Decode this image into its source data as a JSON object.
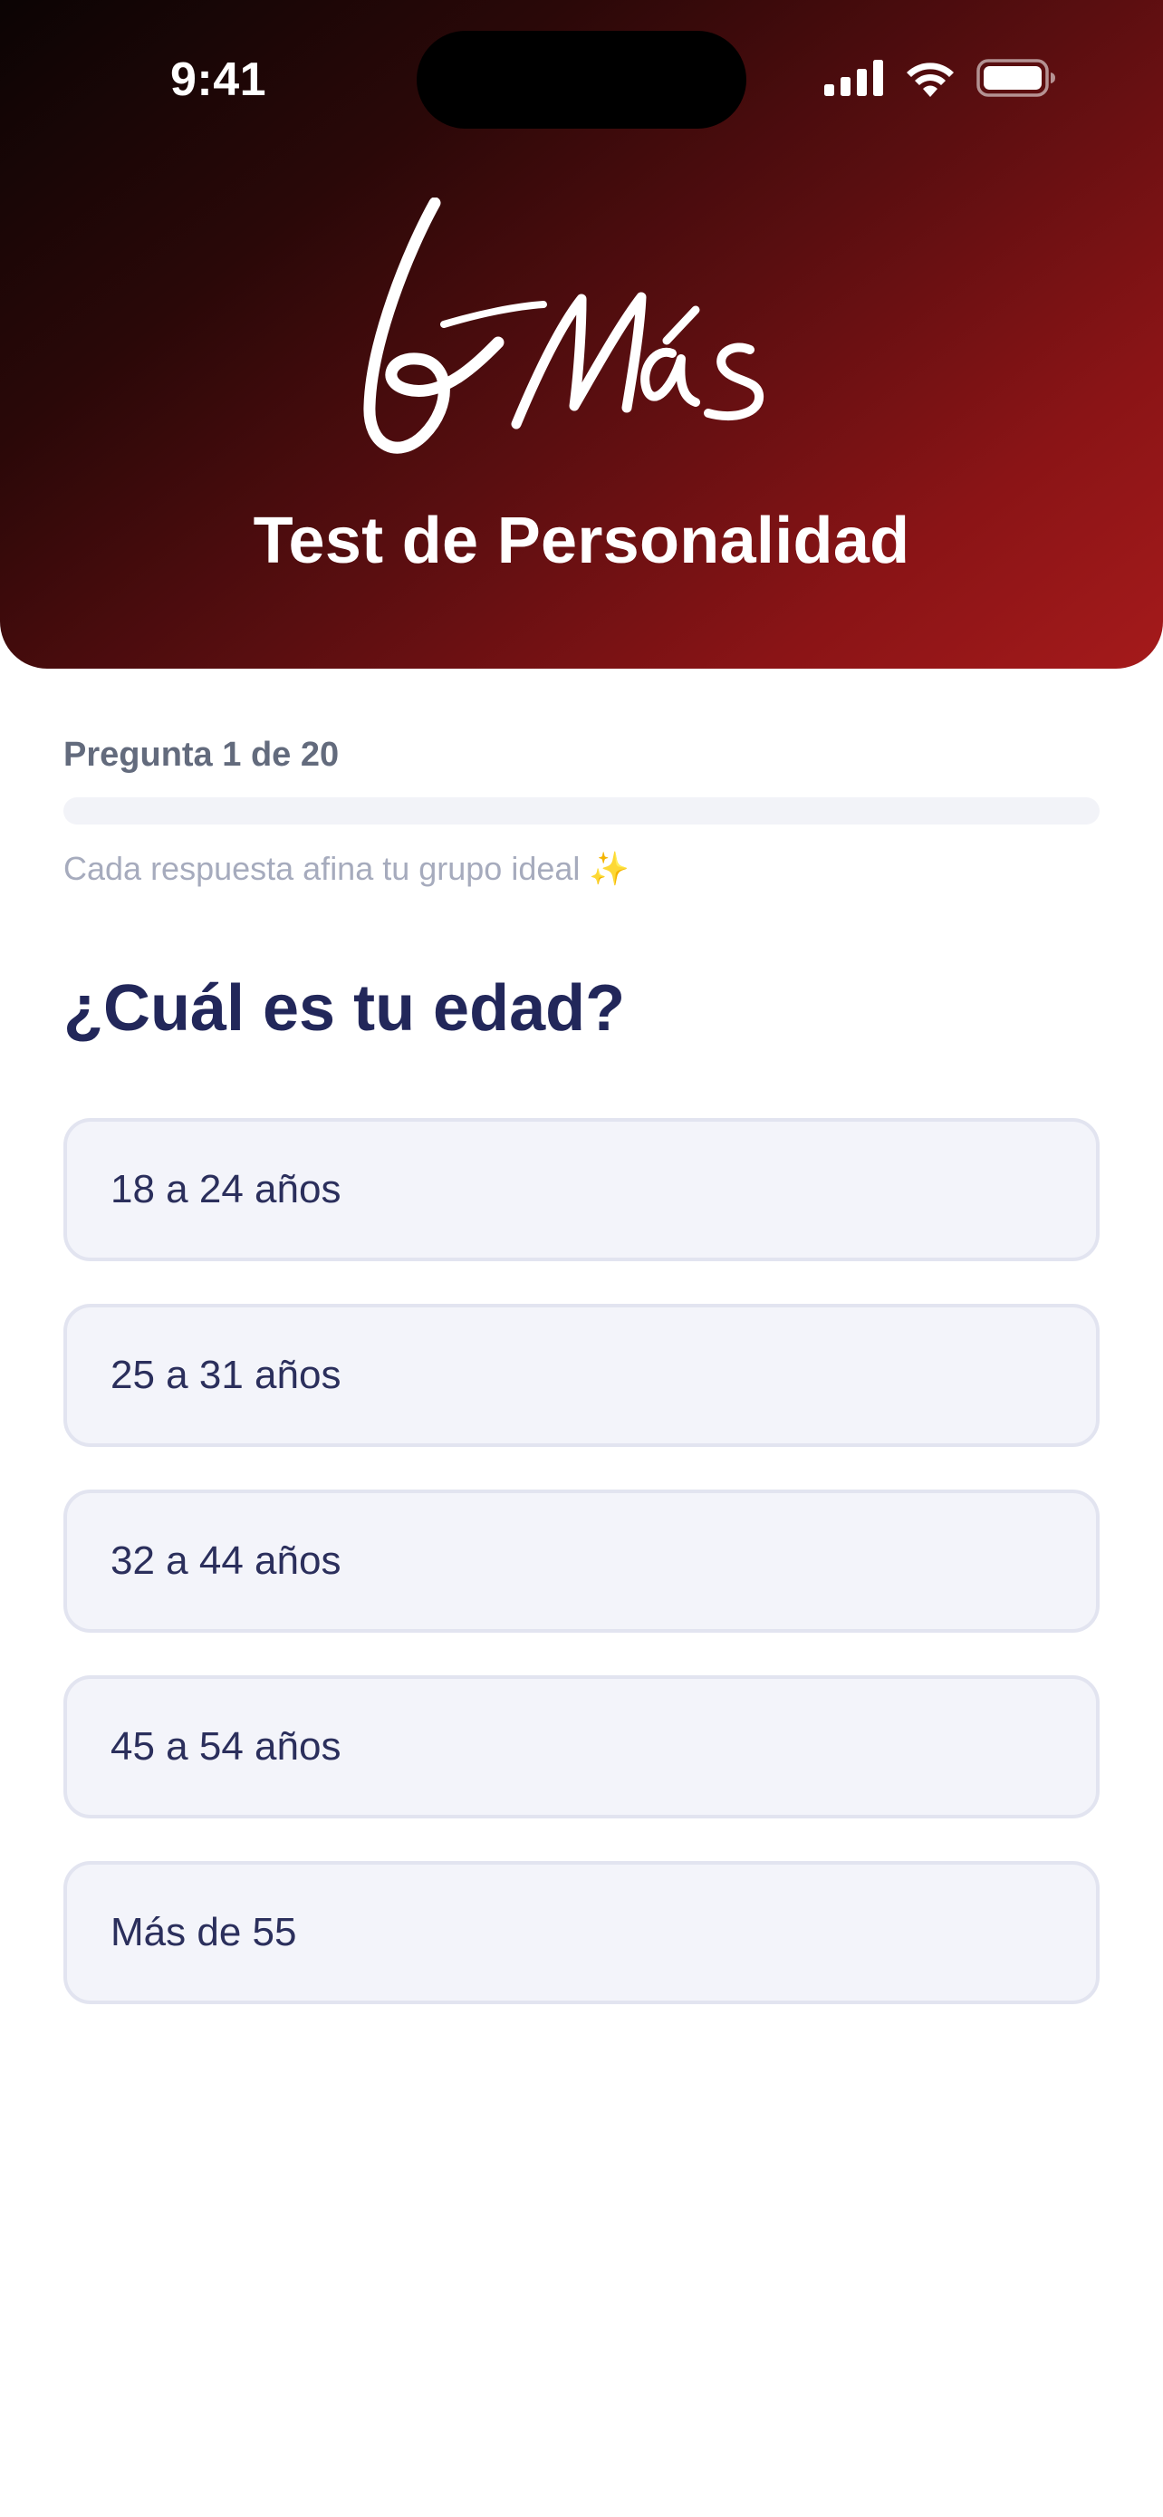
{
  "status_bar": {
    "time": "9:41",
    "icons": [
      "cellular-signal-icon",
      "wifi-icon",
      "battery-icon"
    ]
  },
  "header": {
    "logo_icon": "mas-script-logo",
    "title": "Test de Personalidad",
    "gradient_colors": [
      "#0b0404",
      "#a51a1b"
    ]
  },
  "progress": {
    "label": "Pregunta 1 de 20",
    "current": 1,
    "total": 20,
    "fraction": 0,
    "hint": "Cada respuesta afina tu grupo ideal ✨"
  },
  "question": {
    "text": "¿Cuál es tu edad?",
    "options": [
      {
        "label": "18 a 24 años"
      },
      {
        "label": "25 a 31 años"
      },
      {
        "label": "32 a 44 años"
      },
      {
        "label": "45 a 54 años"
      },
      {
        "label": "Más de 55"
      }
    ]
  },
  "colors": {
    "accent": "#a51a1b",
    "question_text": "#22275a",
    "option_bg": "#f3f4fa",
    "option_border": "#e2e4f0"
  }
}
